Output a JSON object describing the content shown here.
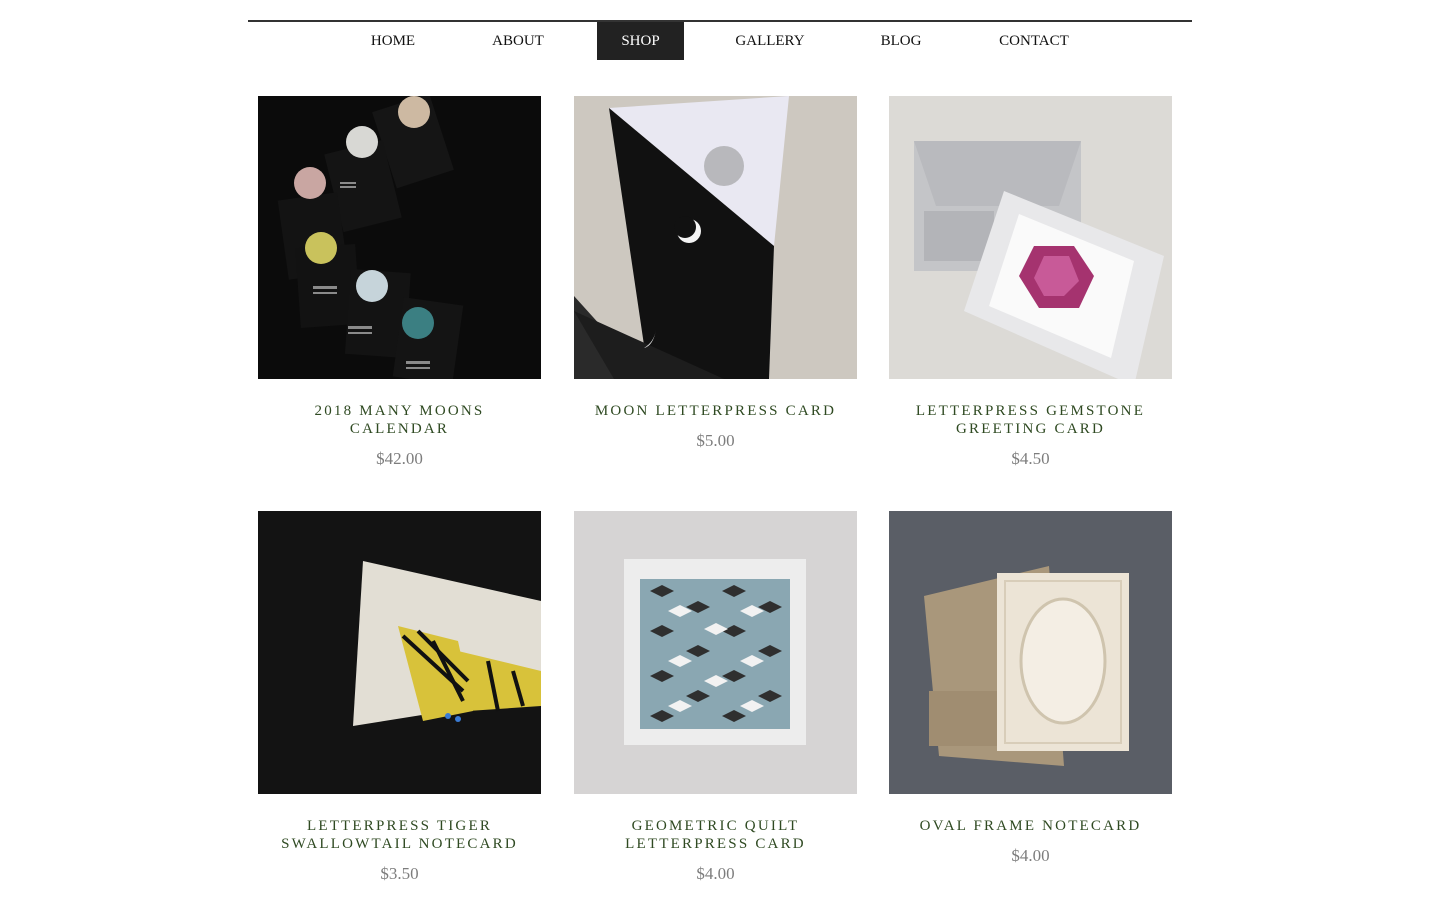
{
  "nav": {
    "items": [
      {
        "label": "HOME",
        "active": false
      },
      {
        "label": "ABOUT",
        "active": false
      },
      {
        "label": "SHOP",
        "active": true
      },
      {
        "label": "GALLERY",
        "active": false
      },
      {
        "label": "BLOG",
        "active": false
      },
      {
        "label": "CONTACT",
        "active": false
      }
    ]
  },
  "products": [
    {
      "title": "2018 Many Moons Calendar",
      "price": "$42.00",
      "image": "moon-calendar-image"
    },
    {
      "title": "Moon Letterpress Card",
      "price": "$5.00",
      "image": "moon-card-image"
    },
    {
      "title": "Letterpress Gemstone Greeting Card",
      "price": "$4.50",
      "image": "gemstone-card-image"
    },
    {
      "title": "Letterpress Tiger Swallowtail Notecard",
      "price": "$3.50",
      "image": "butterfly-notecard-image"
    },
    {
      "title": "Geometric Quilt Letterpress Card",
      "price": "$4.00",
      "image": "quilt-card-image"
    },
    {
      "title": "Oval Frame Notecard",
      "price": "$4.00",
      "image": "oval-frame-notecard-image"
    }
  ]
}
